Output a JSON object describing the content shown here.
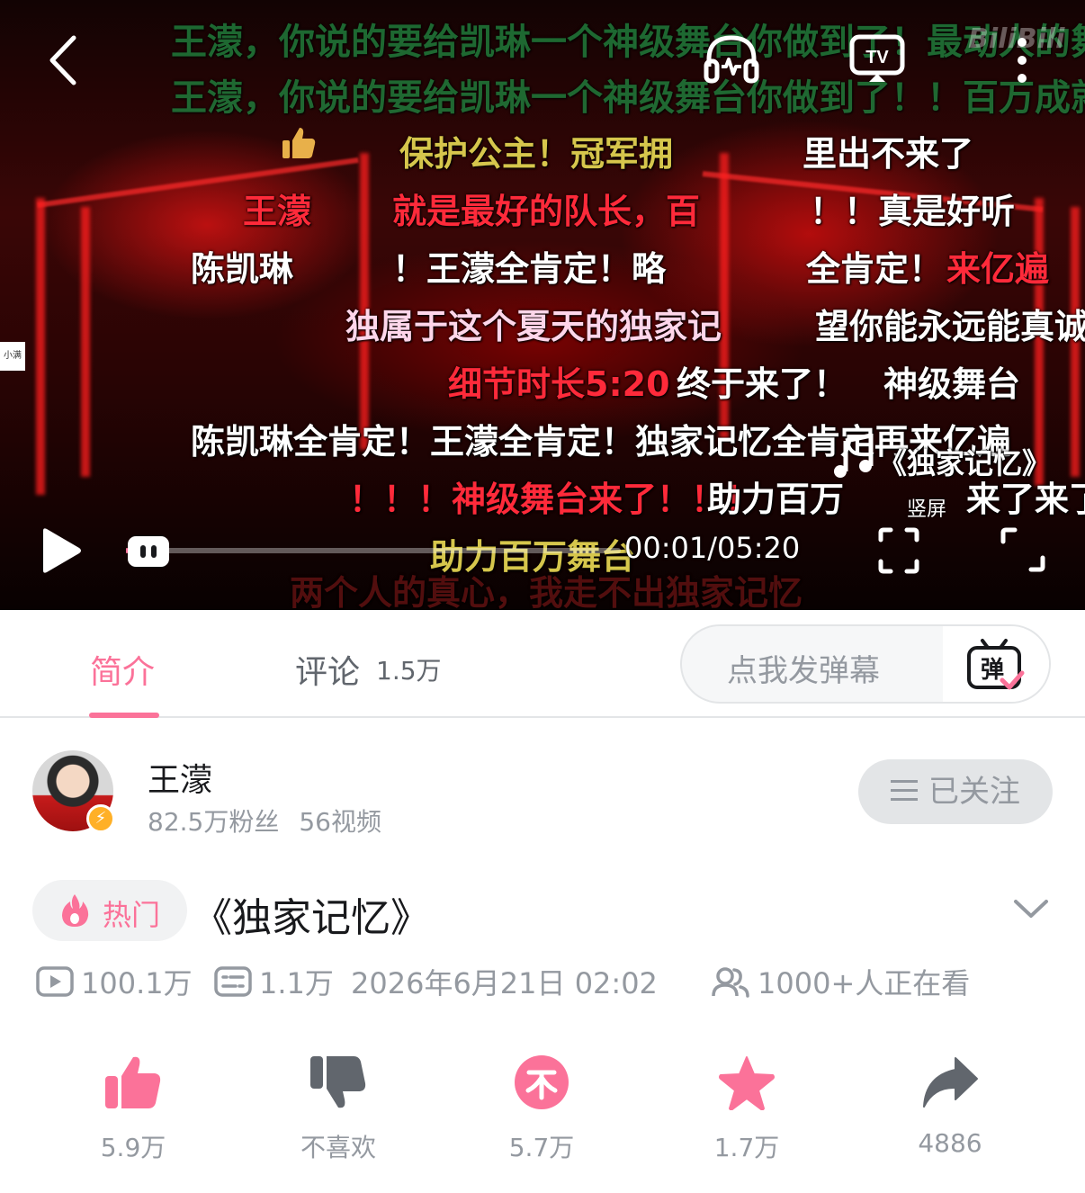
{
  "player": {
    "watermark": "BiliBili",
    "corner_text": "小满",
    "time_display": "00:01/05:20",
    "progress_fraction": 0.003,
    "vertical_mode_label": "竖屏",
    "danmaku": [
      {
        "text": "王濛，你说的要给凯琳一个神级舞台你做到了！最动人的舞",
        "color": "green"
      },
      {
        "text": "王濛，你说的要给凯琳一个神级舞台你做到了！！百万成就",
        "color": "green"
      },
      {
        "text": "保护公主！冠军拥",
        "color": "yellow"
      },
      {
        "text": "里出不来了",
        "color": "white"
      },
      {
        "text": "王濛",
        "color": "red"
      },
      {
        "text": "就是最好的队长，百",
        "color": "red"
      },
      {
        "text": "！！真是好听",
        "color": "white"
      },
      {
        "text": "陈凯琳",
        "color": "white"
      },
      {
        "text": "！王濛全肯定！略",
        "color": "white"
      },
      {
        "text": "全肯定！",
        "color": "white"
      },
      {
        "text": "来亿遍",
        "color": "red"
      },
      {
        "text": "独属于这个夏天的独家记",
        "color": "pink"
      },
      {
        "text": "望你能永远能真诚",
        "color": "white"
      },
      {
        "text": "细节时长5:20",
        "color": "red"
      },
      {
        "text": "终于来了！",
        "color": "white"
      },
      {
        "text": "神级舞台",
        "color": "white"
      },
      {
        "text": "陈凯琳全肯定！王濛全肯定！独家记忆全肯定再来亿遍",
        "color": "white"
      },
      {
        "text": "《独家记忆》",
        "color": "white"
      },
      {
        "text": "！！！神级舞台来了！！！",
        "color": "red"
      },
      {
        "text": "助力百万",
        "color": "white"
      },
      {
        "text": "来了来了",
        "color": "white"
      },
      {
        "text": "助力百万舞台",
        "color": "yellow"
      },
      {
        "text": "两个人的真心，我走不出独家记忆",
        "color": "dark"
      }
    ]
  },
  "tabs": {
    "intro": "简介",
    "comments": "评论",
    "comments_count": "1.5万",
    "danmaku_placeholder": "点我发弹幕",
    "danmaku_button_glyph": "弹"
  },
  "uploader": {
    "name": "王濛",
    "fans": "82.5万粉丝",
    "videos": "56视频",
    "follow_label": "已关注"
  },
  "video": {
    "hot_label": "热门",
    "title": "《独家记忆》",
    "views": "100.1万",
    "danmaku_count": "1.1万",
    "published": "2026年6月21日 02:02",
    "watching": "1000+人正在看"
  },
  "actions": {
    "like": "5.9万",
    "dislike": "不喜欢",
    "coin": "5.7万",
    "favorite": "1.7万",
    "share": "4886"
  },
  "colors": {
    "accent": "#fb7299",
    "muted_text": "#9499a0",
    "dislike_icon": "#61666d",
    "share_icon": "#61666d"
  }
}
